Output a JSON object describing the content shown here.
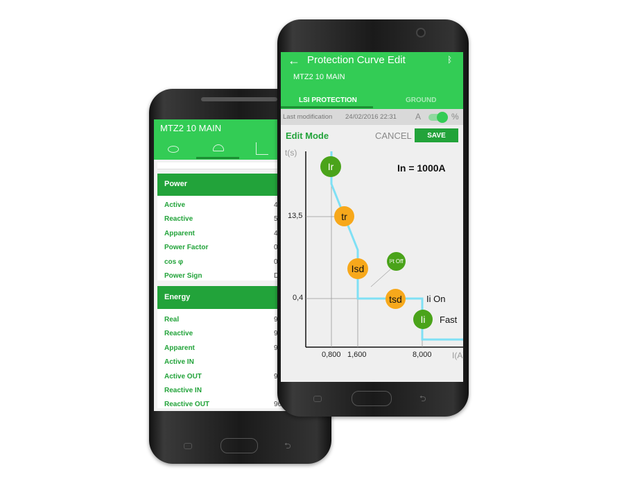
{
  "back_phone": {
    "title": "MTZ2 10 MAIN",
    "tabs": [
      {
        "icon": "eye-icon"
      },
      {
        "icon": "gauge-icon",
        "active": true
      },
      {
        "icon": "curve-icon"
      }
    ],
    "power": {
      "header": "Power",
      "rows": [
        {
          "label": "Active",
          "value": "46"
        },
        {
          "label": "Reactive",
          "value": "5"
        },
        {
          "label": "Apparent",
          "value": "46"
        },
        {
          "label": "Power Factor",
          "value": "0,9"
        },
        {
          "label": "cos φ",
          "value": "0,9"
        },
        {
          "label": "Power Sign",
          "value": "Dire"
        }
      ]
    },
    "energy": {
      "header": "Energy",
      "rows": [
        {
          "label": "Real",
          "value": "964"
        },
        {
          "label": "Reactive",
          "value": "96"
        },
        {
          "label": "Apparent",
          "value": "969"
        },
        {
          "label": "Active IN",
          "value": ""
        },
        {
          "label": "Active OUT",
          "value": "964"
        },
        {
          "label": "Reactive IN",
          "value": ""
        },
        {
          "label": "Reactive OUT",
          "value": "964"
        }
      ]
    }
  },
  "front_phone": {
    "title": "Protection Curve Edit",
    "subtitle": "MTZ2 10 MAIN",
    "tabs": [
      {
        "label": "LSI PROTECTION",
        "active": true
      },
      {
        "label": "GROUND"
      }
    ],
    "last_mod_label": "Last modification",
    "last_mod_value": "24/02/2016 22:31",
    "toggle_left": "A",
    "toggle_right": "%",
    "toggle_on": true,
    "edit_mode": "Edit Mode",
    "cancel": "CANCEL",
    "save": "SAVE",
    "chart": {
      "y_label": "t(s)",
      "x_label": "I(A)",
      "in_label": "In = 1000A",
      "y_ticks": [
        "13,5",
        "0,4"
      ],
      "x_ticks": [
        "0,800",
        "1,600",
        "8,000"
      ],
      "handles": {
        "ir": "Ir",
        "tr": "tr",
        "isd": "Isd",
        "pt": "I²t Off",
        "tsd": "tsd",
        "ii": "Ii"
      },
      "ii_on": "Ii On",
      "fast": "Fast"
    }
  },
  "colors": {
    "primary": "#33cc55",
    "dark_green": "#22a33a",
    "curve": "#7fe0f5",
    "orange": "#f7a81b"
  }
}
